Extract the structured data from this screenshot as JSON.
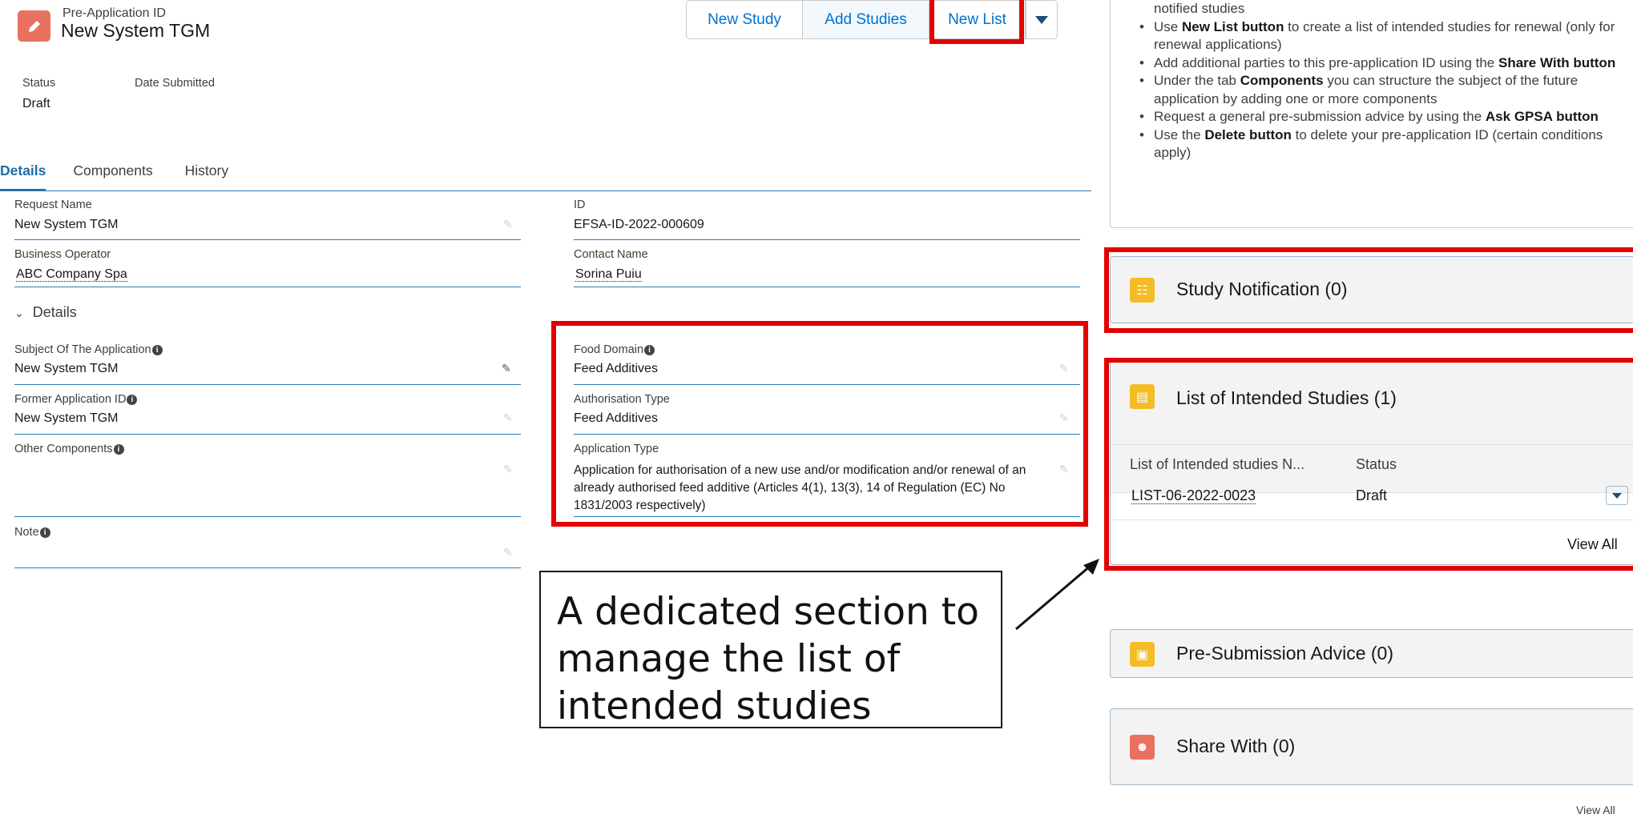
{
  "header": {
    "subtitle": "Pre-Application ID",
    "title": "New System TGM"
  },
  "actions": {
    "new_study": "New Study",
    "add_studies": "Add Studies",
    "new_list": "New List"
  },
  "status": {
    "status_label": "Status",
    "status_value": "Draft",
    "date_label": "Date Submitted"
  },
  "tabs": [
    "Details",
    "Components",
    "History"
  ],
  "fields": {
    "request_name_label": "Request Name",
    "request_name_value": "New System TGM",
    "id_label": "ID",
    "id_value": "EFSA-ID-2022-000609",
    "business_operator_label": "Business Operator",
    "business_operator_value": "ABC Company Spa",
    "contact_name_label": "Contact Name",
    "contact_name_value": "Sorina Puiu",
    "section_label": "Details",
    "subject_label": "Subject Of The Application",
    "subject_value": "New System TGM",
    "food_domain_label": "Food Domain",
    "food_domain_value": "Feed Additives",
    "former_id_label": "Former Application ID",
    "former_id_value": "New System TGM",
    "authorisation_type_label": "Authorisation Type",
    "authorisation_type_value": "Feed Additives",
    "other_components_label": "Other Components",
    "application_type_label": "Application Type",
    "application_type_value": "Application for authorisation of a new use and/or modification and/or renewal of an already authorised feed additive (Articles 4(1), 13(3), 14 of Regulation (EC) No 1831/2003 respectively)",
    "note_label": "Note"
  },
  "help": {
    "line0": "notified studies",
    "b1_pre": "Use ",
    "b1_bold": "New List button",
    "b1_post": " to create a list of intended studies for renewal (only for renewal applications)",
    "b2_pre": "Add additional parties to this pre-application ID using the ",
    "b2_bold": "Share With button",
    "b3_pre": "Under the tab ",
    "b3_bold": "Components",
    "b3_post": " you can structure the subject of the future application by adding one or more components",
    "b4_pre": "Request a general pre-submission advice by using the ",
    "b4_bold": "Ask GPSA button",
    "b5_pre": "Use the ",
    "b5_bold": "Delete button",
    "b5_post": " to delete your pre-application ID (certain conditions apply)"
  },
  "cards": {
    "study_notification": "Study Notification (0)",
    "list_intended": "List of Intended Studies (1)",
    "col_name": "List of Intended studies N...",
    "col_status": "Status",
    "row_name": "LIST-06-2022-0023",
    "row_status": "Draft",
    "view_all": "View All",
    "pre_submission": "Pre-Submission Advice (0)",
    "share_with": "Share With (0)",
    "view_all_bottom": "View All"
  },
  "callout": {
    "text": "A dedicated section to manage the list of intended studies"
  },
  "colors": {
    "annotation_red": "#e30000",
    "link_blue": "#0070d2",
    "tab_blue": "#1b6ea8",
    "orange_icon": "#e8725f",
    "yellow_icon": "#f4bc25"
  }
}
